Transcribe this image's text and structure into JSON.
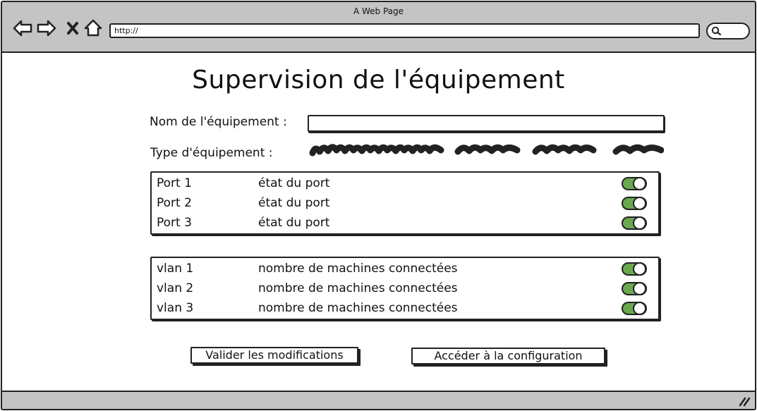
{
  "window": {
    "title": "A Web Page"
  },
  "browser": {
    "url": "http://"
  },
  "page": {
    "title": "Supervision de l'équipement",
    "name_label": "Nom de l'équipement :",
    "name_value": "",
    "type_label": "Type d'équipement :"
  },
  "ports": [
    {
      "name": "Port 1",
      "status": "état du port",
      "enabled": true
    },
    {
      "name": "Port 2",
      "status": "état du port",
      "enabled": true
    },
    {
      "name": "Port 3",
      "status": "état du port",
      "enabled": true
    }
  ],
  "vlans": [
    {
      "name": "vlan 1",
      "info": "nombre de machines connectées",
      "enabled": true
    },
    {
      "name": "vlan 2",
      "info": "nombre de machines connectées",
      "enabled": true
    },
    {
      "name": "vlan 3",
      "info": "nombre de machines connectées",
      "enabled": true
    }
  ],
  "buttons": {
    "validate": "Valider les modifications",
    "configure": "Accéder à la configuration"
  },
  "colors": {
    "toggle_on": "#6aa84f",
    "chrome": "#c4c4c4"
  }
}
